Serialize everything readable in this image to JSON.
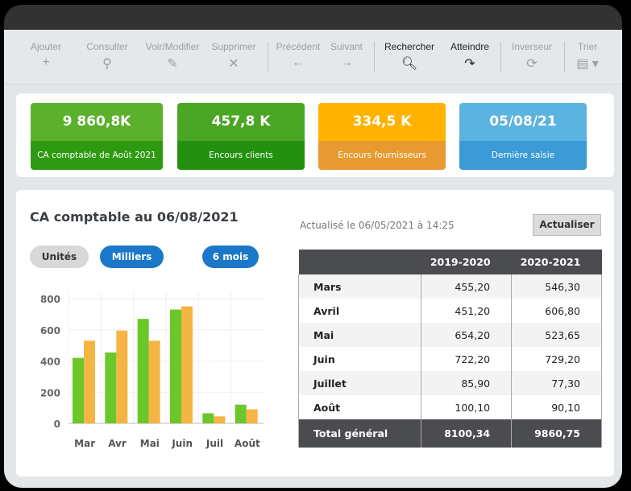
{
  "toolbar": {
    "items": [
      {
        "label": "Ajouter",
        "icon": "plus-icon",
        "glyph": "+"
      },
      {
        "label": "Consulter",
        "icon": "search-icon",
        "glyph": "⚲"
      },
      {
        "label": "Voir/Modifier",
        "icon": "pencil-icon",
        "glyph": "✎"
      },
      {
        "label": "Supprimer",
        "icon": "close-icon",
        "glyph": "✕"
      },
      {
        "label": "Précédent",
        "icon": "arrow-left-icon",
        "glyph": "←"
      },
      {
        "label": "Suivant",
        "icon": "arrow-right-icon",
        "glyph": "→"
      },
      {
        "label": "Rechercher",
        "icon": "search-icon",
        "glyph": "🔍︎"
      },
      {
        "label": "Atteindre",
        "icon": "redo-icon",
        "glyph": "↷"
      },
      {
        "label": "Inverseur",
        "icon": "refresh-icon",
        "glyph": "⟳"
      },
      {
        "label": "Trier",
        "icon": "document-dropdown-icon",
        "glyph": "▤ ▾"
      }
    ]
  },
  "kpis": [
    {
      "value": "9 860,8K",
      "label": "CA comptable de Août 2021",
      "top": "#5bb02c",
      "bottom": "#2e9a12"
    },
    {
      "value": "457,8 K",
      "label": "Encours clients",
      "top": "#4aa624",
      "bottom": "#239010"
    },
    {
      "value": "334,5 K",
      "label": "Encours fournisseurs",
      "top": "#ffb300",
      "bottom": "#e89a30"
    },
    {
      "value": "05/08/21",
      "label": "Dernière saisie",
      "top": "#5bb3e0",
      "bottom": "#3c9bd6"
    }
  ],
  "main": {
    "title": "CA comptable au 06/08/2021",
    "pills": {
      "units": "Unités",
      "thousands": "Milliers",
      "period": "6 mois"
    },
    "updated": "Actualisé le 06/05/2021 à 14:25",
    "refresh": "Actualiser"
  },
  "table": {
    "headers": [
      "",
      "2019-2020",
      "2020-2021"
    ],
    "rows": [
      [
        "Mars",
        "455,20",
        "546,30"
      ],
      [
        "Avril",
        "451,20",
        "606,80"
      ],
      [
        "Mai",
        "654,20",
        "523,65"
      ],
      [
        "Juin",
        "722,20",
        "729,20"
      ],
      [
        "Juillet",
        "85,90",
        "77,30"
      ],
      [
        "Août",
        "100,10",
        "90,10"
      ]
    ],
    "total": [
      "Total général",
      "8100,34",
      "9860,75"
    ]
  },
  "chart_data": {
    "type": "bar",
    "categories": [
      "Mar",
      "Avr",
      "Mai",
      "Juin",
      "Juil",
      "Août"
    ],
    "series": [
      {
        "values": [
          420,
          455,
          670,
          730,
          65,
          120
        ],
        "color": "#6cc72a"
      },
      {
        "values": [
          530,
          595,
          530,
          750,
          45,
          90
        ],
        "color": "#f5b543"
      }
    ],
    "yticks": [
      0,
      200,
      400,
      600,
      800
    ],
    "ylim": [
      0,
      800
    ],
    "grid": true
  }
}
